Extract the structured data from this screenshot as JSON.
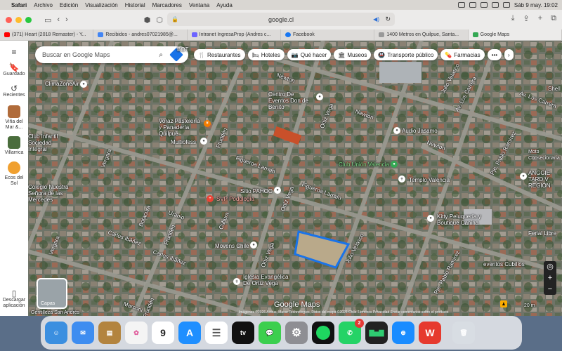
{
  "menubar": {
    "apple": "",
    "app": "Safari",
    "items": [
      "Archivo",
      "Edición",
      "Visualización",
      "Historial",
      "Marcadores",
      "Ventana",
      "Ayuda"
    ],
    "datetime": "Sáb 9 may.  19:02"
  },
  "toolbar": {
    "url": "google.cl"
  },
  "tabs": [
    {
      "label": "(371) Heart (2018 Remaster) - Y...",
      "color": "#ff0000"
    },
    {
      "label": "Recibidos - andres07021985@...",
      "color": "#4285f4"
    },
    {
      "label": "Intranet IngresaProp (Andres c...",
      "color": "#6c63ff"
    },
    {
      "label": "Facebook",
      "color": "#1877f2"
    },
    {
      "label": "1400 Metros en Quilpue, Santa...",
      "color": "#999999"
    },
    {
      "label": "Google Maps",
      "color": "#34a853"
    }
  ],
  "sidebar": {
    "menu": "≡",
    "saved": "Guardado",
    "recent": "Recientes",
    "places": [
      {
        "label": "Viña del Mar &...",
        "color": "#b06b3a"
      },
      {
        "label": "Villarrica",
        "color": "#4a6d3c"
      },
      {
        "label": "Ecos del Sol",
        "color": "#f0a030"
      }
    ],
    "download": "Descargar aplicación"
  },
  "search": {
    "placeholder": "Buscar en Google Maps"
  },
  "chips": [
    {
      "icon": "fork-knife-icon",
      "glyph": "🍴",
      "label": "Restaurantes"
    },
    {
      "icon": "bed-icon",
      "glyph": "🛏",
      "label": "Hoteles"
    },
    {
      "icon": "camera-icon",
      "glyph": "📷",
      "label": "Qué hacer"
    },
    {
      "icon": "museum-icon",
      "glyph": "🏛",
      "label": "Museos"
    },
    {
      "icon": "transit-icon",
      "glyph": "🚇",
      "label": "Transporte público"
    },
    {
      "icon": "pharmacy-icon",
      "glyph": "💊",
      "label": "Farmacias"
    },
    {
      "icon": "more-icon",
      "glyph": "",
      "label": "•••"
    }
  ],
  "places": [
    {
      "label": "ClimaZoneAir",
      "color": "#ffffff"
    },
    {
      "label": "Centro De Eventos Don de Benito",
      "color": "#ffffff"
    },
    {
      "label": "Voraz Pastelería y Panadería Quilpué",
      "color": "#ffffff"
    },
    {
      "label": "Multiofess",
      "color": "#ffffff"
    },
    {
      "label": "Club Infantil Sociedad Integral",
      "color": "#ffffff"
    },
    {
      "label": "Audio Jasamo",
      "color": "#ffffff"
    },
    {
      "label": "Club Unión Valencia",
      "color": "#7fe08a"
    },
    {
      "label": "Templo Valencia",
      "color": "#ffffff"
    },
    {
      "label": "Colegio Nuestra Señora de las Mercedes",
      "color": "#ffffff"
    },
    {
      "label": "SVP Podología",
      "color": "#ffb0a8"
    },
    {
      "label": "Sitio PAHOC",
      "color": "#ffffff"
    },
    {
      "label": "Kitty Peluquería y Boutique Canina",
      "color": "#ffffff"
    },
    {
      "label": "Movens Chile",
      "color": "#ffffff"
    },
    {
      "label": "Ferial Libre",
      "color": "#ffffff"
    },
    {
      "label": "eventos Cubillos",
      "color": "#ffffff"
    },
    {
      "label": "Iglesia Evangélica De Ortiz Vega",
      "color": "#ffffff"
    },
    {
      "label": "ANGGIE TARD V REGIÓN",
      "color": "#ffffff"
    },
    {
      "label": "Moto Consecionaria",
      "color": "#ffffff"
    },
    {
      "label": "Shell",
      "color": "#ffffff"
    },
    {
      "label": "Gentilleza San Andrés",
      "color": "#ffffff"
    },
    {
      "label": "BOT",
      "color": "#ffffff"
    }
  ],
  "streets": [
    "Newton",
    "Newton",
    "Newton",
    "Av. Los Carrera",
    "Av. Los Carrera",
    "Julio Velasco",
    "Julio Velasco",
    "Figueroa Larraín",
    "Figueroa Larraín",
    "Ortiz Vega",
    "Ortiz Vega",
    "Ortiz Vega",
    "Fruddén",
    "Fruddén",
    "Fruddén",
    "Vergara",
    "Vergara",
    "Carlos Ibáñez",
    "Carlos Ibáñez",
    "Pje. Pablo Ramírez",
    "Pje. Pablo Ramírez",
    "Marconi",
    "Cultura",
    "Uranio",
    "Botacura"
  ],
  "map_ui": {
    "layers_label": "Capas",
    "attribution": "Imágenes ©2026 Airbus, Maxar Technologies, Datos del mapa ©2026   Chile   Términos   Privacidad   Enviar comentarios sobre el producto",
    "logo": "Google Maps",
    "scale": "20 m"
  },
  "dock": [
    {
      "name": "finder",
      "color": "#3b8fe0",
      "text": ""
    },
    {
      "name": "mail",
      "color": "#3e8df0",
      "text": "✉"
    },
    {
      "name": "contacts",
      "color": "#b3843f",
      "text": ""
    },
    {
      "name": "photos",
      "color": "#f4f4f4",
      "text": "✿"
    },
    {
      "name": "calendar",
      "color": "#ffffff",
      "text": "9"
    },
    {
      "name": "app-store",
      "color": "#1f8fff",
      "text": "A"
    },
    {
      "name": "reminders",
      "color": "#ffffff",
      "text": "☰"
    },
    {
      "name": "apple-tv",
      "color": "#111111",
      "text": "tv"
    },
    {
      "name": "messages",
      "color": "#3ccf4e",
      "text": "💬"
    },
    {
      "name": "system-settings",
      "color": "#8e8e93",
      "text": "⚙"
    },
    {
      "name": "spotify",
      "color": "#111111",
      "text": ""
    },
    {
      "name": "whatsapp",
      "color": "#25d366",
      "text": "",
      "badge": "2"
    },
    {
      "name": "stocks",
      "color": "#222222",
      "text": ""
    },
    {
      "name": "safari",
      "color": "#1a8cff",
      "text": ""
    },
    {
      "name": "wps-office",
      "color": "#e63a2e",
      "text": "W"
    },
    {
      "name": "trash",
      "color": "#d8dde3",
      "text": "🗑"
    }
  ]
}
